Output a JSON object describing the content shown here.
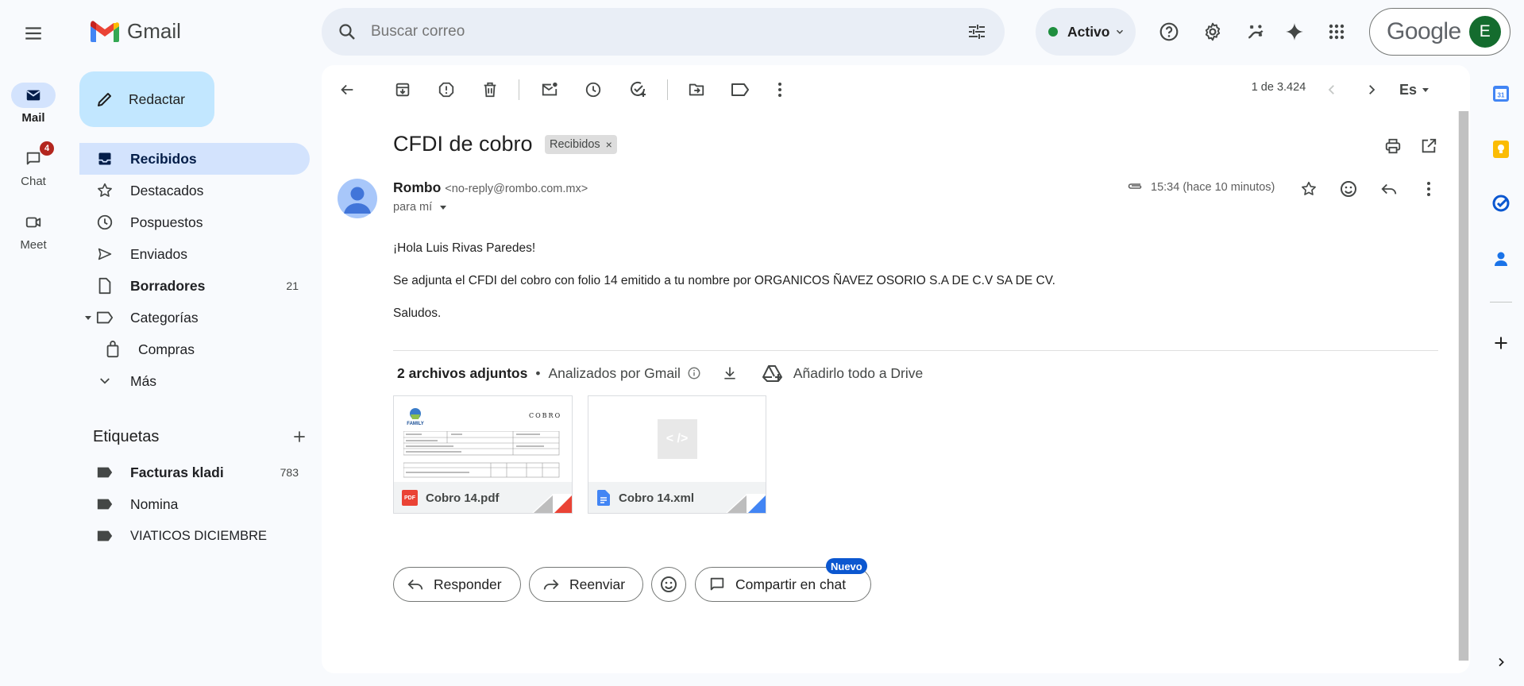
{
  "app": {
    "name": "Gmail"
  },
  "search": {
    "placeholder": "Buscar correo"
  },
  "status": {
    "label": "Activo"
  },
  "account": {
    "brand": "Google",
    "avatar_initial": "E"
  },
  "rail": [
    {
      "label": "Mail"
    },
    {
      "label": "Chat",
      "badge": "4"
    },
    {
      "label": "Meet"
    }
  ],
  "compose": {
    "label": "Redactar"
  },
  "nav": {
    "inbox": "Recibidos",
    "starred": "Destacados",
    "snoozed": "Pospuestos",
    "sent": "Enviados",
    "drafts": "Borradores",
    "drafts_count": "21",
    "categories": "Categorías",
    "purchases": "Compras",
    "more": "Más"
  },
  "labels": {
    "header": "Etiquetas",
    "items": [
      {
        "name": "Facturas kladi",
        "count": "783"
      },
      {
        "name": "Nomina",
        "count": ""
      },
      {
        "name": "VIATICOS DICIEMBRE",
        "count": ""
      }
    ]
  },
  "toolbar": {
    "pagination": "1 de 3.424",
    "lang": "Es"
  },
  "email": {
    "subject": "CFDI de cobro",
    "label_chip": "Recibidos",
    "sender_name": "Rombo",
    "sender_email": "<no-reply@rombo.com.mx>",
    "to": "para mí",
    "time": "15:34 (hace 10 minutos)",
    "body": [
      "¡Hola Luis Rivas Paredes!",
      "Se adjunta el CFDI del cobro con folio 14 emitido a tu nombre por ORGANICOS ÑAVEZ OSORIO S.A DE C.V SA DE CV.",
      "Saludos."
    ]
  },
  "attachments": {
    "summary": "2 archivos adjuntos",
    "scanned": "Analizados por Gmail",
    "drive": "Añadirlo todo a Drive",
    "files": [
      {
        "name": "Cobro 14.pdf",
        "type": "PDF",
        "preview_title": "COBRO",
        "preview_logo": "FAMILY"
      },
      {
        "name": "Cobro 14.xml",
        "type": "XML",
        "preview_glyph": "< />"
      }
    ]
  },
  "actions": {
    "reply": "Responder",
    "forward": "Reenviar",
    "share": "Compartir en chat",
    "new_badge": "Nuevo"
  },
  "side_panel": {
    "calendar_day": "31"
  },
  "colors": {
    "accent": "#0b57d0",
    "selected_bg": "#d3e3fd",
    "compose_bg": "#c2e7ff",
    "status_green": "#1e8e3e",
    "avatar_bg": "#146c2e",
    "pdf_red": "#ea4335",
    "doc_blue": "#4285f4"
  }
}
